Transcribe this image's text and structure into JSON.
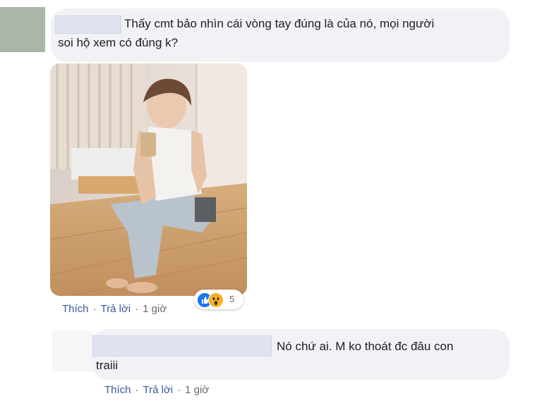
{
  "comment": {
    "text_line1": "Thấy cmt bảo nhìn cái vòng tay đúng là của nó, mọi người",
    "text_line2": "soi hộ xem có đúng k?",
    "actions": {
      "like": "Thích",
      "reply": "Trả lời",
      "time": "1 giờ",
      "separator": "·"
    },
    "reactions": {
      "icons": [
        "like-icon",
        "wow-icon"
      ],
      "count": "5"
    }
  },
  "reply": {
    "text_line1": "Nó chứ ai. M ko thoát đc đâu con",
    "text_line2": "traiii",
    "actions": {
      "like": "Thích",
      "reply": "Trả lời",
      "time": "1 giờ",
      "separator": "·"
    }
  },
  "colors": {
    "bubble": "#f0f2f5",
    "link": "#385898",
    "meta": "#65676b",
    "like": "#1877f2",
    "wow": "#f7b125"
  }
}
